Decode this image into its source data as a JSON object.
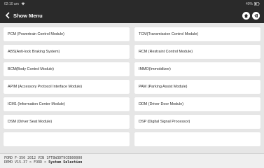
{
  "status": {
    "time": "02:10 am",
    "battery": "40%",
    "wifi_icon": "wifi-icon",
    "battery_icon": "battery-icon"
  },
  "header": {
    "title": "Show Menu",
    "back_icon": "chevron-left-icon",
    "home_icon": "home-icon",
    "exit_icon": "exit-icon"
  },
  "menu": {
    "items": [
      "PCM (Powertrain Control Module)",
      "TCM(Transmission Control Module)",
      "ABS(Anti-lock Braking System)",
      "RCM (Restraint Control Module)",
      "BCM(Body Control Module)",
      "IMMO(Immobilizer)",
      "APIM (Accessory Protocol Interface Module)",
      "PAM (Parking Assist Module)",
      "ICM1 (Information Center Module)",
      "DDM (Driver Door Module)",
      "DSM (Driver Seat Module)",
      "DSP (Digital Signal Processor)"
    ]
  },
  "footer": {
    "vehicle_info": "FORD  F-350  2012  VIN  1FT8W3DT9CEB00000",
    "path_prefix": "DEMO V15.37 > FORD > ",
    "path_current": "System Selection"
  }
}
